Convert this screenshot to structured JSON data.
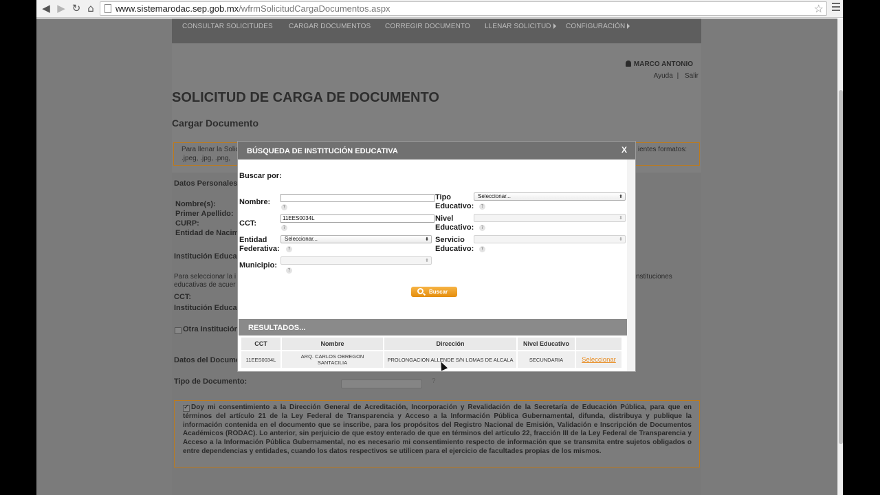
{
  "browser": {
    "url_host": "www.sistemarodac.sep.gob.mx",
    "url_path": "/wfrmSolicitudCargaDocumentos.aspx"
  },
  "nav": {
    "items": [
      "CONSULTAR SOLICITUDES",
      "CARGAR DOCUMENTOS",
      "CORREGIR DOCUMENTO",
      "LLENAR SOLICITUD",
      "CONFIGURACIÓN"
    ]
  },
  "user": {
    "name": "MARCO ANTONIO",
    "help": "Ayuda",
    "sep": "|",
    "logout": "Salir"
  },
  "page": {
    "title": "SOLICITUD DE CARGA DE DOCUMENTO",
    "subtitle": "Cargar Documento",
    "info_line1": "Para llenar la Solic",
    "info_line2": ".jpeg, .jpg, .png,",
    "info_right": "ientes formatos:"
  },
  "form": {
    "personal": "Datos Personales:",
    "nombres": "Nombre(s):",
    "primer_apellido": "Primer Apellido:",
    "curp": "CURP:",
    "entidad_nac": "Entidad de Nacim",
    "institucion_section": "Institución Educat",
    "select_note1": "Para seleccionar la i",
    "select_note2": "educativas de acuer",
    "select_note_right": "nstituciones",
    "cct": "CCT:",
    "institucion": "Institución Educat",
    "otra": "Otra Institución",
    "datos_doc": "Datos del Docume",
    "tipo_doc": "Tipo de Documento:",
    "help": "?"
  },
  "consent": {
    "text": "Doy mi consentimiento a la Dirección General de Acreditación, Incorporación y Revalidación de la Secretaría de Educación Pública, para que en términos del artículo 21 de la Ley Federal de Transparencia y Acceso a la Información Pública Gubernamental, difunda, distribuya y publique la información contenida en el documento que se inscribe, para los propósitos del Registro Nacional de Emisión, Validación e Inscripción de Documentos Académicos (RODAC). Lo anterior, sin perjuicio de que estoy enterado de que en términos del artículo 22, fracción III de la Ley Federal de Transparencia y Acceso a la Información Pública Gubernamental, no es necesario mi consentimiento respecto de información que se transmita entre sujetos obligados o entre dependencias y entidades, cuando los datos respectivos se utilicen para el ejercicio de facultades propias de los mismos."
  },
  "modal": {
    "title": "BÚSQUEDA DE INSTITUCIÓN EDUCATIVA",
    "close": "X",
    "buscar_por": "Buscar por:",
    "nombre_label": "Nombre:",
    "nombre_value": "",
    "cct_label": "CCT:",
    "cct_value": "11EES0034L",
    "entidad_label1": "Entidad",
    "entidad_label2": "Federativa:",
    "entidad_value": "Seleccionar...",
    "municipio_label": "Municipio:",
    "municipio_value": "",
    "tipo_label1": "Tipo",
    "tipo_label2": "Educativo:",
    "tipo_value": "Seleccionar...",
    "nivel_label1": "Nivel",
    "nivel_label2": "Educativo:",
    "nivel_value": "",
    "servicio_label1": "Servicio",
    "servicio_label2": "Educativo:",
    "servicio_value": "",
    "help": "?",
    "search_button": "Buscar",
    "results_title": "RESULTADOS...",
    "columns": [
      "CCT",
      "Nombre",
      "Dirección",
      "Nivel Educativo",
      ""
    ],
    "rows": [
      {
        "cct": "11EES0034L",
        "nombre_l1": "ARQ. CARLOS OBREGON",
        "nombre_l2": "SANTACILIA",
        "direccion": "PROLONGACION ALLENDE S/N LOMAS DE ALCALA",
        "nivel": "SECUNDARIA",
        "action": "Seleccionar"
      }
    ]
  },
  "icons": {
    "back": "back-arrow-icon",
    "forward": "forward-arrow-icon",
    "reload": "reload-icon",
    "home": "home-icon",
    "star": "bookmark-star-icon",
    "menu": "menu-icon",
    "user": "user-icon",
    "search": "magnifier-icon"
  },
  "colors": {
    "accent": "#e8891b",
    "overlay_gray": "#7f7f7f",
    "modal_header": "#717171"
  }
}
